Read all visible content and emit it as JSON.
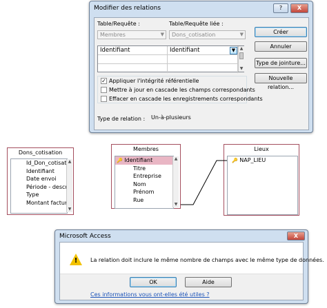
{
  "relations_dialog": {
    "title": "Modifier des relations",
    "help_btn": "?",
    "close_btn": "X",
    "table_label": "Table/Requête :",
    "related_label": "Table/Requête liée :",
    "table_value": "Membres",
    "related_value": "Dons_cotisation",
    "grid_rows": [
      {
        "left": "Identifiant",
        "right": "Identifiant"
      },
      {
        "left": "",
        "right": ""
      },
      {
        "left": "",
        "right": ""
      }
    ],
    "check_integrity": {
      "label": "Appliquer l'intégrité référentielle",
      "checked": true
    },
    "check_cascade_update": {
      "label": "Mettre à jour en cascade les champs correspondants",
      "checked": false
    },
    "check_cascade_delete": {
      "label": "Effacer en cascade les enregistrements correspondants",
      "checked": false
    },
    "relation_type_label": "Type de relation :",
    "relation_type_value": "Un-à-plusieurs",
    "buttons": {
      "create": "Créer",
      "cancel": "Annuler",
      "join_type": "Type de jointure...",
      "new_relation": "Nouvelle relation..."
    }
  },
  "tables": {
    "dons": {
      "name": "Dons_cotisation",
      "fields": [
        "Id_Don_cotisation",
        "Identifiant",
        "Date envoi",
        "Période - description",
        "Type",
        "Montant facturé"
      ]
    },
    "membres": {
      "name": "Membres",
      "fields": [
        "Identifiant",
        "Titre",
        "Entreprise",
        "Nom",
        "Prénom",
        "Rue"
      ]
    },
    "lieux": {
      "name": "Lieux",
      "fields": [
        "NAP_LIEU"
      ]
    }
  },
  "access_dialog": {
    "title": "Microsoft Access",
    "close_btn": "X",
    "message": "La relation doit inclure le même nombre de champs avec le même type de données.",
    "ok": "OK",
    "help": "Aide",
    "link": "Ces informations vous ont-elles été utiles ?"
  },
  "colors": {
    "dialog_frame": "#cfdff0",
    "table_border": "#a44d5d",
    "selected_row": "#e9b6c4",
    "link": "#1a52b8",
    "warning": "#f3c200"
  }
}
